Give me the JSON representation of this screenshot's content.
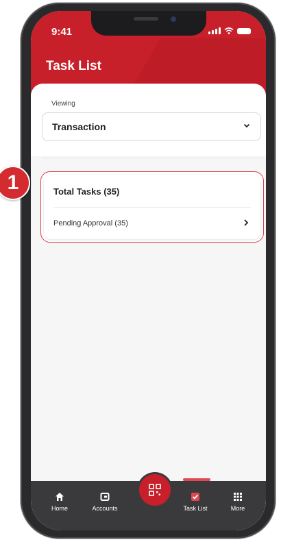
{
  "status_bar": {
    "time": "9:41"
  },
  "header": {
    "title": "Task List"
  },
  "viewing": {
    "label": "Viewing",
    "selected": "Transaction"
  },
  "tasks": {
    "total_label": "Total Tasks (35)",
    "items": [
      {
        "label": "Pending Approval (35)"
      }
    ]
  },
  "callout": {
    "number": "1"
  },
  "bottom_nav": {
    "items": [
      {
        "label": "Home",
        "icon": "home-icon"
      },
      {
        "label": "Accounts",
        "icon": "wallet-icon"
      },
      {
        "label": "",
        "icon": "qr-scan-icon"
      },
      {
        "label": "Task List",
        "icon": "task-check-icon",
        "active": true
      },
      {
        "label": "More",
        "icon": "grid-icon"
      }
    ]
  },
  "colors": {
    "brand_red": "#c8202a",
    "nav_bg": "#3a3a3c",
    "callout_red": "#d42b30"
  }
}
